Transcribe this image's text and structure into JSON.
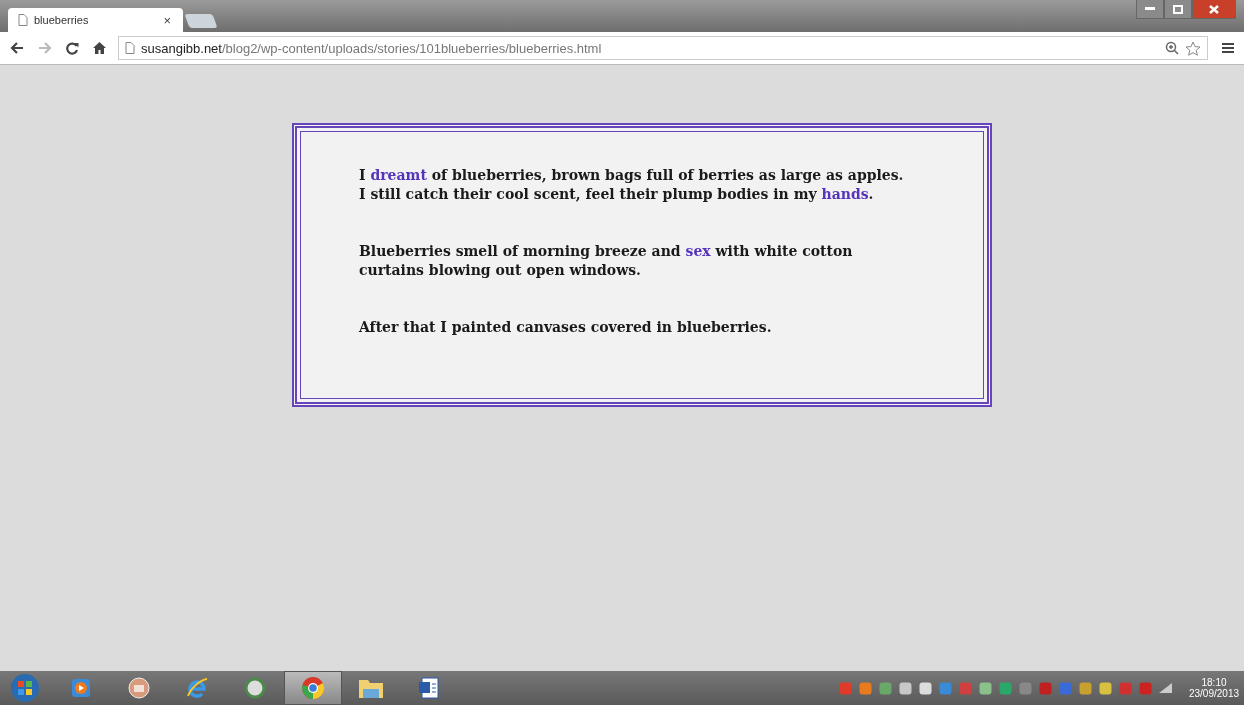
{
  "tabs": [
    {
      "title": "blueberries",
      "selected": true,
      "close": "×"
    }
  ],
  "address": {
    "domain": "susangibb.net",
    "path": "/blog2/wp-content/uploads/stories/101blueberries/blueberries.html"
  },
  "paragraphs": [
    [
      {
        "kind": "text",
        "text": "I "
      },
      {
        "kind": "link",
        "text": "dreamt"
      },
      {
        "kind": "text",
        "text": " of blueberries, brown bags full of berries as large as apples. I still catch their cool scent, feel their plump bodies in my "
      },
      {
        "kind": "link",
        "text": "hands"
      },
      {
        "kind": "text",
        "text": "."
      }
    ],
    [
      {
        "kind": "text",
        "text": "Blueberries smell of morning breeze and "
      },
      {
        "kind": "link",
        "text": "sex"
      },
      {
        "kind": "text",
        "text": " with white cotton curtains blowing out open windows."
      }
    ],
    [
      {
        "kind": "text",
        "text": "After that I painted canvases covered in blueberries."
      }
    ]
  ],
  "taskbar": {
    "apps": [
      {
        "selected": false
      },
      {
        "selected": false
      },
      {
        "selected": false
      },
      {
        "selected": false
      },
      {
        "selected": true
      },
      {
        "selected": false
      },
      {
        "selected": false
      }
    ],
    "clock": {
      "time": "18:10",
      "date": "23/09/2013"
    }
  }
}
